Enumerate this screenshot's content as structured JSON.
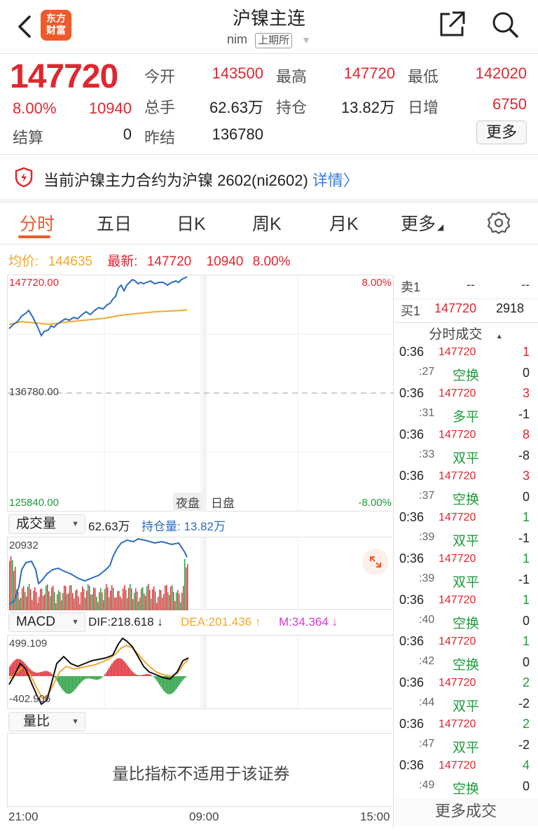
{
  "header": {
    "back_icon": "chevron-left-icon",
    "logo_text": "东方财富",
    "logo_line1": "东方",
    "logo_line2": "财富",
    "title": "沪镍主连",
    "subtitle": "nim",
    "exchange": "上期所",
    "share_icon": "share-icon",
    "search_icon": "search-icon"
  },
  "quote": {
    "price": "147720",
    "change_pct": "8.00%",
    "change": "10940",
    "open_label": "今开",
    "open": "143500",
    "high_label": "最高",
    "high": "147720",
    "low_label": "最低",
    "low": "142020",
    "volume_label": "总手",
    "volume": "62.63万",
    "oi_label": "持仓",
    "oi": "13.82万",
    "daily_inc_label": "日增",
    "daily_inc": "6750",
    "settle_label": "结算",
    "settle": "0",
    "prev_settle_label": "昨结",
    "prev_settle": "136780",
    "more_label": "更多"
  },
  "notice": {
    "text": "当前沪镍主力合约为沪镍 2602(ni2602)",
    "link": "详情"
  },
  "tabs": [
    "分时",
    "五日",
    "日K",
    "周K",
    "月K",
    "更多"
  ],
  "info_line": {
    "avg_label": "均价:",
    "avg": "144635",
    "latest_label": "最新:",
    "latest": "147720",
    "change": "10940",
    "pct": "8.00%"
  },
  "main_chart": {
    "top_price": "147720.00",
    "top_pct": "8.00%",
    "mid_price": "136780.00",
    "bottom_price": "125840.00",
    "bottom_pct": "-8.00%",
    "session_night": "夜盘",
    "session_day": "日盘"
  },
  "volume_panel": {
    "selector": "成交量",
    "volume": "62.63万",
    "oi_text": "持仓量: 13.82万",
    "max_label": "20932"
  },
  "macd_panel": {
    "selector": "MACD",
    "dif": "DIF:218.618 ↓",
    "dea": "DEA:201.436 ↑",
    "m": "M:34.364 ↓",
    "max_label": "499.109",
    "min_label": "-402.906"
  },
  "ratio_panel": {
    "selector": "量比",
    "message": "量比指标不适用于该证券"
  },
  "time_axis": [
    "21:00",
    "09:00",
    "15:00"
  ],
  "order_book": {
    "sell_label": "卖1",
    "sell_price": "--",
    "sell_vol": "--",
    "buy_label": "买1",
    "buy_price": "147720",
    "buy_vol": "2918"
  },
  "trades_header": "分时成交",
  "trades": [
    {
      "time": "0:36",
      "price": "147720",
      "vol": "1",
      "vol_color": "red"
    },
    {
      "time": ":27",
      "type": "空换",
      "vol": "0",
      "vol_color": "dark"
    },
    {
      "time": "0:36",
      "price": "147720",
      "vol": "3",
      "vol_color": "red"
    },
    {
      "time": ":31",
      "type": "多平",
      "vol": "-1",
      "vol_color": "dark"
    },
    {
      "time": "0:36",
      "price": "147720",
      "vol": "8",
      "vol_color": "red"
    },
    {
      "time": ":33",
      "type": "双平",
      "vol": "-8",
      "vol_color": "dark"
    },
    {
      "time": "0:36",
      "price": "147720",
      "vol": "3",
      "vol_color": "red"
    },
    {
      "time": ":37",
      "type": "空换",
      "vol": "0",
      "vol_color": "dark"
    },
    {
      "time": "0:36",
      "price": "147720",
      "vol": "1",
      "vol_color": "green"
    },
    {
      "time": ":39",
      "type": "双平",
      "vol": "-1",
      "vol_color": "dark"
    },
    {
      "time": "0:36",
      "price": "147720",
      "vol": "1",
      "vol_color": "green"
    },
    {
      "time": ":39",
      "type": "双平",
      "vol": "-1",
      "vol_color": "dark"
    },
    {
      "time": "0:36",
      "price": "147720",
      "vol": "1",
      "vol_color": "green"
    },
    {
      "time": ":40",
      "type": "空换",
      "vol": "0",
      "vol_color": "dark"
    },
    {
      "time": "0:36",
      "price": "147720",
      "vol": "1",
      "vol_color": "green"
    },
    {
      "time": ":42",
      "type": "空换",
      "vol": "0",
      "vol_color": "dark"
    },
    {
      "time": "0:36",
      "price": "147720",
      "vol": "2",
      "vol_color": "green"
    },
    {
      "time": ":44",
      "type": "双平",
      "vol": "-2",
      "vol_color": "dark"
    },
    {
      "time": "0:36",
      "price": "147720",
      "vol": "2",
      "vol_color": "green"
    },
    {
      "time": ":47",
      "type": "双平",
      "vol": "-2",
      "vol_color": "dark"
    },
    {
      "time": "0:36",
      "price": "147720",
      "vol": "4",
      "vol_color": "green"
    },
    {
      "time": ":49",
      "type": "空换",
      "vol": "0",
      "vol_color": "dark"
    }
  ],
  "more_trades": "更多成交",
  "colors": {
    "up": "#e0262f",
    "down": "#1e9b3a",
    "price_line": "#2a6cc0",
    "avg_line": "#f0a830",
    "brand": "#ef5a2a",
    "link": "#3a7bd5"
  }
}
